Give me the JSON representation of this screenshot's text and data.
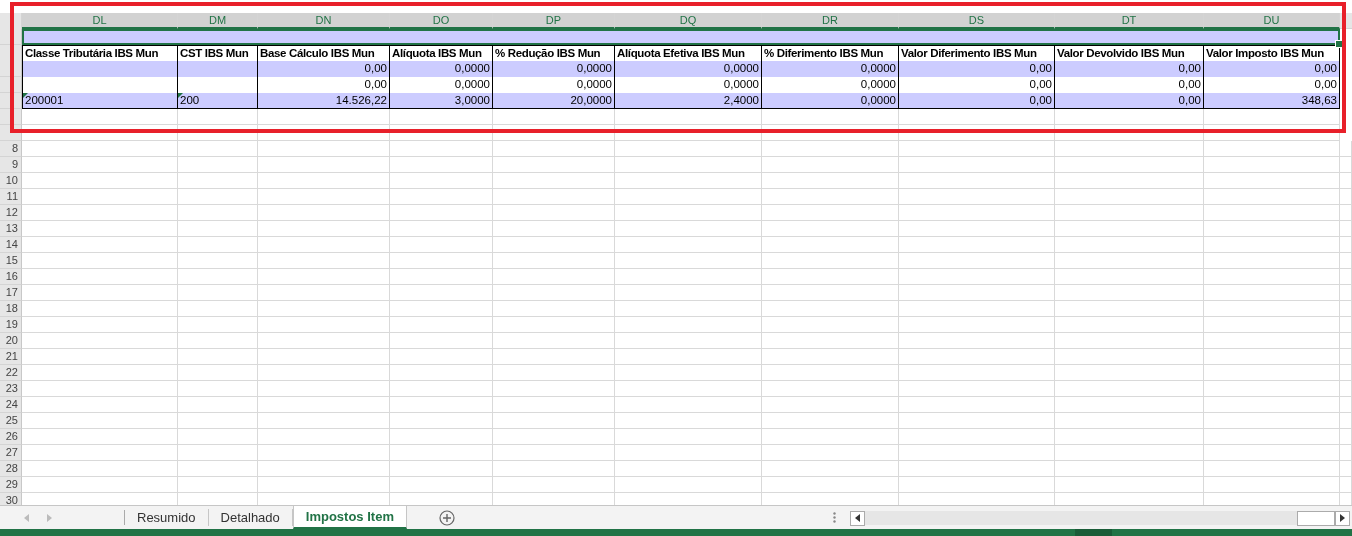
{
  "columns": [
    {
      "label": "DL",
      "selected": true
    },
    {
      "label": "DM",
      "selected": true
    },
    {
      "label": "DN",
      "selected": true
    },
    {
      "label": "DO",
      "selected": true
    },
    {
      "label": "DP",
      "selected": true
    },
    {
      "label": "DQ",
      "selected": true
    },
    {
      "label": "DR",
      "selected": true
    },
    {
      "label": "DS",
      "selected": true
    },
    {
      "label": "DT",
      "selected": true
    },
    {
      "label": "DU",
      "selected": true
    }
  ],
  "banner_row": {
    "shaded": true,
    "selected": true
  },
  "table": {
    "headers": [
      "Classe Tributária IBS Mun",
      "CST IBS Mun",
      "Base Cálculo IBS Mun",
      "Alíquota IBS Mun",
      "% Redução IBS Mun",
      "Alíquota Efetiva IBS Mun",
      "% Diferimento IBS Mun",
      "Valor Diferimento IBS Mun",
      "Valor Devolvido IBS Mun",
      "Valor Imposto IBS Mun"
    ],
    "rows": [
      {
        "shaded": true,
        "cells": [
          {
            "flagged": false
          },
          {
            "flagged": false
          },
          {
            "text": "0,00",
            "flagged": false
          },
          {
            "text": "0,0000",
            "flagged": false
          },
          {
            "text": "0,0000",
            "flagged": false
          },
          {
            "text": "0,0000",
            "flagged": false
          },
          {
            "text": "0,0000",
            "flagged": false
          },
          {
            "text": "0,00",
            "flagged": false
          },
          {
            "text": "0,00",
            "flagged": false
          },
          {
            "text": "0,00",
            "flagged": false
          }
        ]
      },
      {
        "shaded": false,
        "cells": [
          {
            "flagged": false
          },
          {
            "flagged": false
          },
          {
            "text": "0,00",
            "flagged": false
          },
          {
            "text": "0,0000",
            "flagged": false
          },
          {
            "text": "0,0000",
            "flagged": false
          },
          {
            "text": "0,0000",
            "flagged": false
          },
          {
            "text": "0,0000",
            "flagged": false
          },
          {
            "text": "0,00",
            "flagged": false
          },
          {
            "text": "0,00",
            "flagged": false
          },
          {
            "text": "0,00",
            "flagged": false
          }
        ]
      },
      {
        "shaded": true,
        "cells": [
          {
            "text": "200001",
            "flagged": true
          },
          {
            "text": "200",
            "flagged": true
          },
          {
            "text": "14.526,22",
            "flagged": false
          },
          {
            "text": "3,0000",
            "flagged": false
          },
          {
            "text": "20,0000",
            "flagged": false
          },
          {
            "text": "2,4000",
            "flagged": false
          },
          {
            "text": "0,0000",
            "flagged": false
          },
          {
            "text": "0,00",
            "flagged": false
          },
          {
            "text": "0,00",
            "flagged": false
          },
          {
            "text": "348,63",
            "flagged": false
          }
        ]
      }
    ]
  },
  "row_numbers": [
    "8",
    "9",
    "10",
    "11",
    "12",
    "13",
    "14",
    "15",
    "16",
    "17",
    "18",
    "19",
    "20",
    "21",
    "22",
    "23",
    "24",
    "25",
    "26",
    "27",
    "28",
    "29",
    "30"
  ],
  "sheet_tabs": [
    {
      "label": "Resumido",
      "selected": false
    },
    {
      "label": "Detalhado",
      "selected": false
    },
    {
      "label": "Impostos Item",
      "selected": true
    }
  ]
}
